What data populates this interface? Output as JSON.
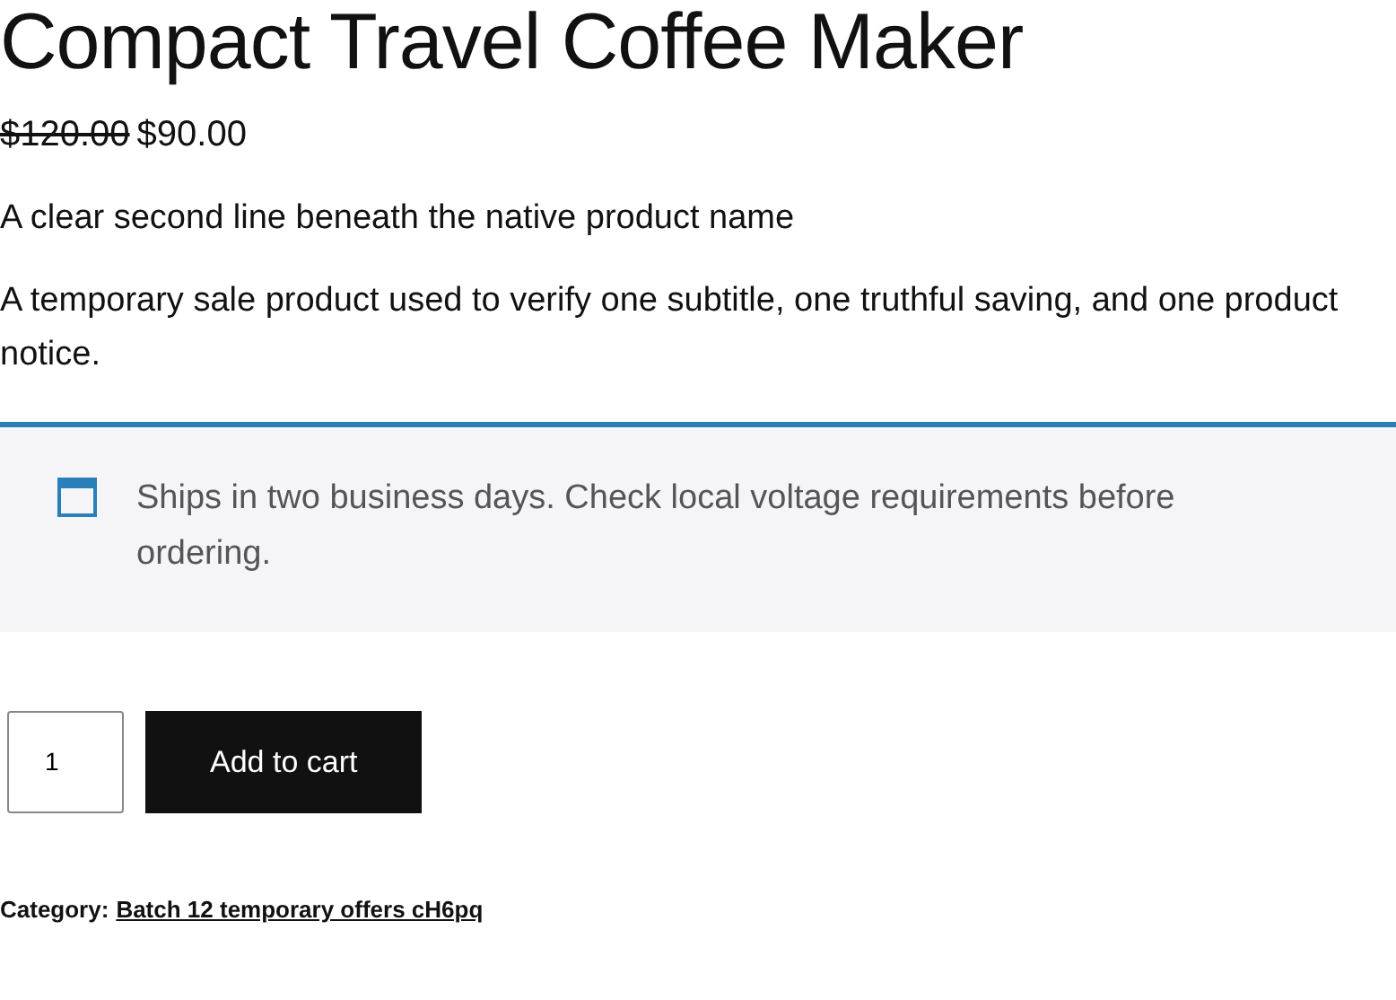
{
  "product": {
    "title": "Compact Travel Coffee Maker",
    "regular_price": "$120.00",
    "sale_price": "$90.00",
    "subtitle": "A clear second line beneath the native product name",
    "description": "A temporary sale product used to verify one subtitle, one truthful saving, and one product notice."
  },
  "notice": {
    "text": "Ships in two business days. Check local voltage requirements before ordering."
  },
  "cart": {
    "quantity": "1",
    "button": "Add to cart"
  },
  "meta": {
    "label": "Category:",
    "link": "Batch 12 temporary offers cH6pq"
  }
}
